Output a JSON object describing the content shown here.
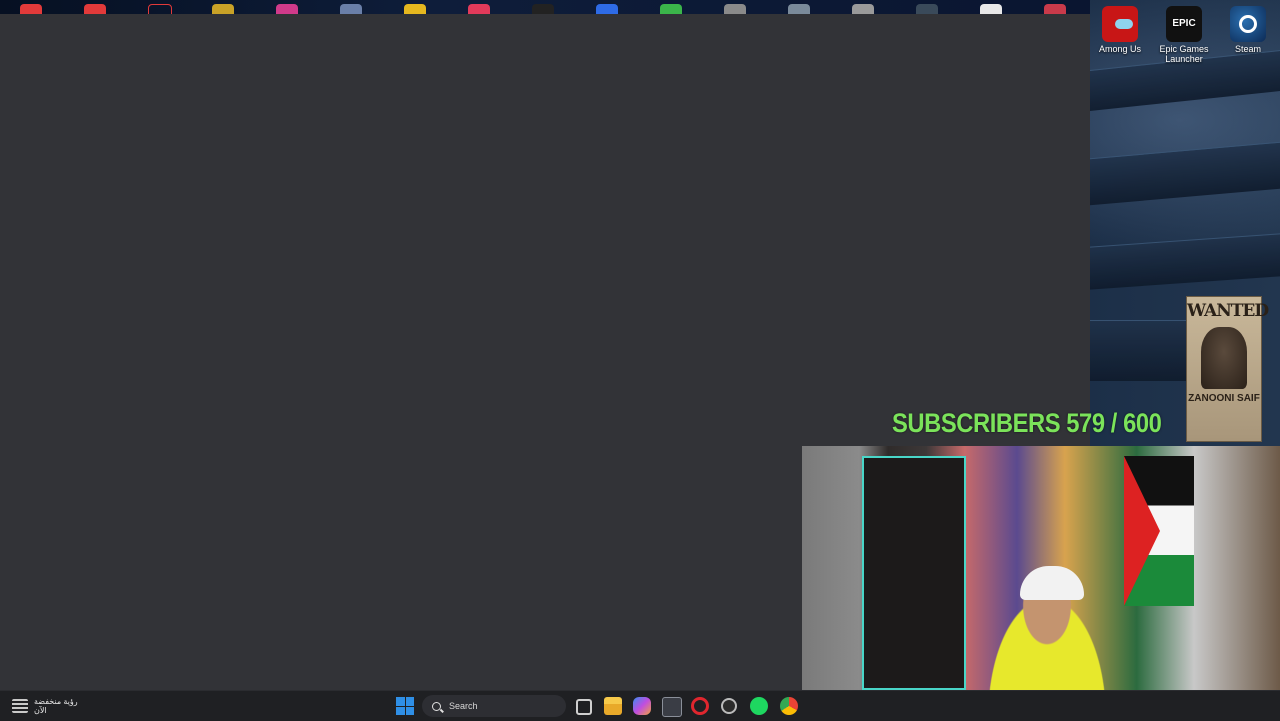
{
  "desktop": {
    "icons": [
      {
        "label": "Among Us",
        "icon": "among-us-icon"
      },
      {
        "label": "Epic Games Launcher",
        "icon": "epic-games-icon",
        "glyph_text": "EPIC"
      },
      {
        "label": "Steam",
        "icon": "steam-icon"
      }
    ],
    "poster": {
      "title": "WANTED",
      "name": "ZANOONI SAIF"
    }
  },
  "overlay": {
    "subscribers_text": "SUBSCRIBERS 579 / 600",
    "subscribers_current": 579,
    "subscribers_goal": 600,
    "accent_color": "#7be35a"
  },
  "taskbar": {
    "weather_label": "رؤية منخفضة",
    "weather_sub": "الآن",
    "search_placeholder": "Search",
    "pinned": [
      "windows-start-icon",
      "search-icon",
      "task-view-icon",
      "file-explorer-icon",
      "copilot-icon",
      "store-icon",
      "opera-icon",
      "obs-icon",
      "spotify-icon",
      "chrome-icon"
    ]
  }
}
